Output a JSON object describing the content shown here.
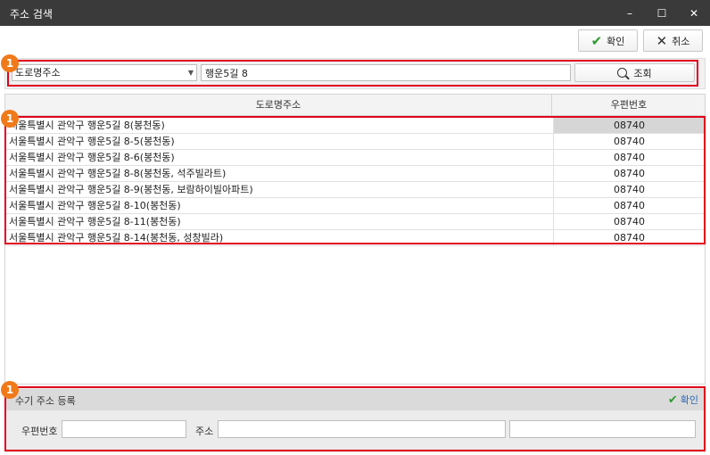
{
  "window": {
    "title": "주소 검색",
    "controls": [
      "–",
      "☐",
      "✕"
    ]
  },
  "toolbar": {
    "ok_label": "확인",
    "cancel_label": "취소"
  },
  "search": {
    "type_selected": "도로명주소",
    "query_value": "행운5길 8",
    "button_label": "조회"
  },
  "table": {
    "headers": [
      "도로명주소",
      "우편번호"
    ],
    "rows": [
      {
        "address": "서울특별시 관악구 행운5길 8(봉천동)",
        "zip": "08740"
      },
      {
        "address": "서울특별시 관악구 행운5길 8-5(봉천동)",
        "zip": "08740"
      },
      {
        "address": "서울특별시 관악구 행운5길 8-6(봉천동)",
        "zip": "08740"
      },
      {
        "address": "서울특별시 관악구 행운5길 8-8(봉천동, 석주빌라트)",
        "zip": "08740"
      },
      {
        "address": "서울특별시 관악구 행운5길 8-9(봉천동, 보람하이빌아파트)",
        "zip": "08740"
      },
      {
        "address": "서울특별시 관악구 행운5길 8-10(봉천동)",
        "zip": "08740"
      },
      {
        "address": "서울특별시 관악구 행운5길 8-11(봉천동)",
        "zip": "08740"
      },
      {
        "address": "서울특별시 관악구 행운5길 8-14(봉천동, 성창빌라)",
        "zip": "08740"
      }
    ]
  },
  "manual": {
    "title": "수기 주소 등록",
    "ok_label": "확인",
    "zip_label": "우편번호",
    "address_label": "주소",
    "zip_value": "",
    "address_value": "",
    "address_detail_value": ""
  },
  "annotations": {
    "badge_1": "1",
    "badge_2": "1",
    "badge_3": "1"
  },
  "colors": {
    "highlight_border": "#e0001b",
    "badge": "#f07a1a",
    "titlebar": "#3a3a3a",
    "ok_check": "#2e9a2e",
    "link": "#2a67b8"
  }
}
